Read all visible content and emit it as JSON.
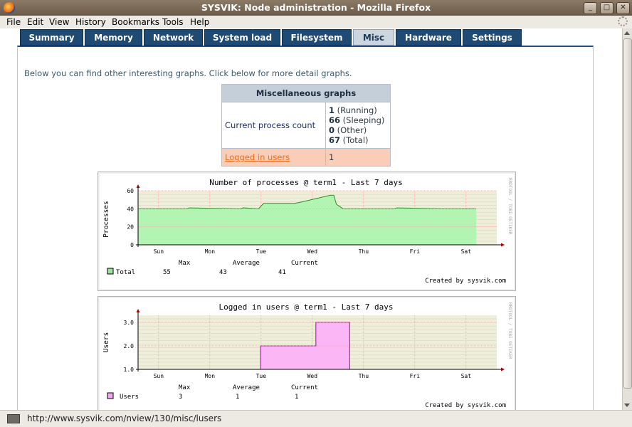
{
  "window": {
    "title": "SYSVIK: Node administration - Mozilla Firefox"
  },
  "menu": [
    {
      "label": "File",
      "key": "file"
    },
    {
      "label": "Edit",
      "key": "edit"
    },
    {
      "label": "View",
      "key": "view"
    },
    {
      "label": "History",
      "key": "history"
    },
    {
      "label": "Bookmarks",
      "key": "bookmarks"
    },
    {
      "label": "Tools",
      "key": "tools"
    },
    {
      "label": "Help",
      "key": "help"
    }
  ],
  "tabs": [
    {
      "label": "Summary",
      "active": false
    },
    {
      "label": "Memory",
      "active": false
    },
    {
      "label": "Network",
      "active": false
    },
    {
      "label": "System load",
      "active": false
    },
    {
      "label": "Filesystem",
      "active": false
    },
    {
      "label": "Misc",
      "active": true
    },
    {
      "label": "Hardware",
      "active": false
    },
    {
      "label": "Settings",
      "active": false
    }
  ],
  "intro_text": "Below you can find other interesting graphs. Click below for more detail graphs.",
  "misc_table": {
    "header": "Miscellaneous graphs",
    "process_label": "Current process count",
    "process_counts": [
      {
        "value": "1",
        "label": "(Running)"
      },
      {
        "value": "66",
        "label": "(Sleeping)"
      },
      {
        "value": "0",
        "label": "(Other)"
      },
      {
        "value": "67",
        "label": "(Total)"
      }
    ],
    "users_link": "Logged in users",
    "users_value": "1"
  },
  "graphs": {
    "processes": {
      "title": "Number of processes @ term1 - Last 7 days",
      "ylabel": "Processes",
      "side_text": "RRDTOOL / TOBI OETIKER",
      "legend": {
        "series": "Total",
        "max": "55",
        "average": "43",
        "current": "41"
      },
      "credit": "Created by sysvik.com",
      "colors": {
        "fill": "#b2f5b2",
        "line": "#2e8a2e",
        "swatch": "#9ae39a"
      }
    },
    "users": {
      "title": "Logged in users @ term1 - Last 7 days",
      "ylabel": "Users",
      "side_text": "RRDTOOL / TOBI OETIKER",
      "legend": {
        "series": "Users",
        "max": "3",
        "average": "1",
        "current": "1"
      },
      "credit": "Created by sysvik.com",
      "colors": {
        "fill": "#fbb6f6",
        "line": "#a40aa0",
        "swatch": "#f5a6f0"
      }
    }
  },
  "legend_headers": {
    "max": "Max",
    "average": "Average",
    "current": "Current"
  },
  "chart_data": [
    {
      "type": "area",
      "title": "Number of processes @ term1 - Last 7 days",
      "ylabel": "Processes",
      "categories": [
        "Sun",
        "Mon",
        "Tue",
        "Wed",
        "Thu",
        "Fri",
        "Sat"
      ],
      "ylim": [
        0,
        60
      ],
      "yticks": [
        0,
        20,
        40,
        60
      ],
      "grid": true,
      "x": [
        0,
        0.95,
        1.0,
        2.0,
        2.05,
        2.35,
        2.45,
        3.05,
        3.15,
        3.75,
        3.82,
        3.87,
        4.0,
        5.0,
        5.05,
        6.0,
        6.6
      ],
      "y": [
        40,
        40,
        41,
        40,
        41,
        40,
        46,
        46,
        47,
        55,
        55,
        45,
        40,
        40,
        41,
        40,
        40
      ],
      "series": [
        {
          "name": "Total"
        }
      ]
    },
    {
      "type": "area",
      "title": "Logged in users @ term1 - Last 7 days",
      "ylabel": "Users",
      "categories": [
        "Sun",
        "Mon",
        "Tue",
        "Wed",
        "Thu",
        "Fri",
        "Sat"
      ],
      "ylim": [
        1.0,
        3.3
      ],
      "yticks": [
        1.0,
        2.0,
        3.0
      ],
      "grid": true,
      "x": [
        0,
        2.39,
        2.39,
        3.47,
        3.47,
        4.13,
        4.13,
        6.6
      ],
      "y": [
        1,
        1,
        2,
        2,
        3,
        3,
        1,
        1
      ],
      "series": [
        {
          "name": "Users"
        }
      ]
    }
  ],
  "status": {
    "url": "http://www.sysvik.com/nview/130/misc/lusers"
  }
}
